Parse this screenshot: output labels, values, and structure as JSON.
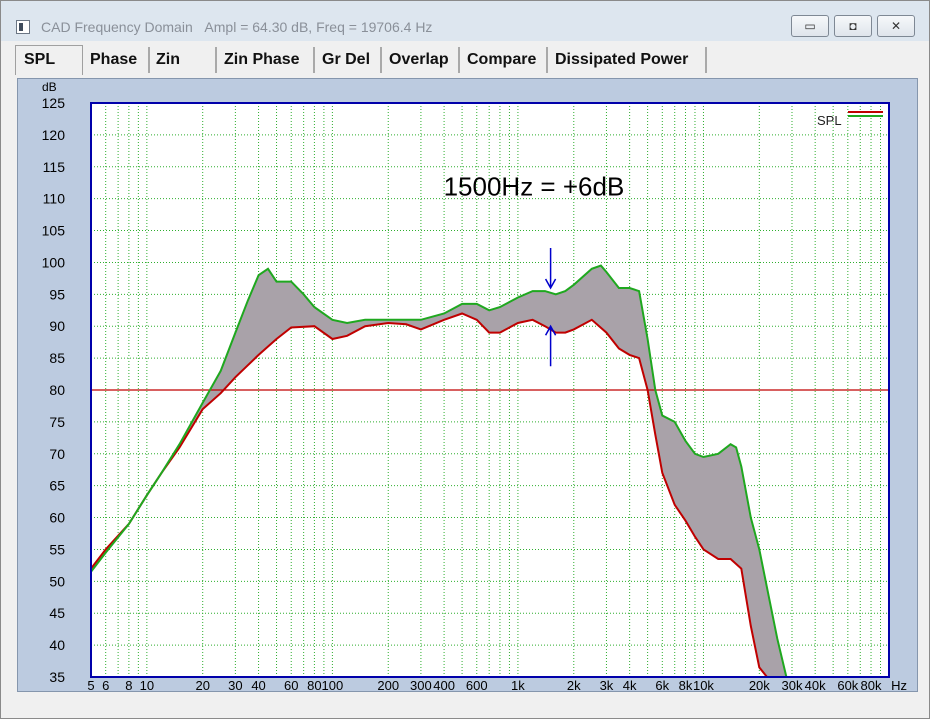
{
  "window": {
    "title": "CAD Frequency Domain",
    "readout": "Ampl = 64.30 dB, Freq = 19706.4 Hz",
    "buttons": {
      "minimize": "▭",
      "maximize": "◘",
      "close": "✕"
    }
  },
  "tabs": [
    {
      "label": "SPL"
    },
    {
      "label": "Phase"
    },
    {
      "label": "Zin"
    },
    {
      "label": "Zin Phase"
    },
    {
      "label": "Gr Del"
    },
    {
      "label": "Overlap"
    },
    {
      "label": "Compare"
    },
    {
      "label": "Dissipated Power"
    }
  ],
  "active_tab": "SPL",
  "colors": {
    "plot_bg": "#ffffff",
    "plot_border": "#0000aa",
    "grid": "#2fae2f",
    "series_red": "#c00000",
    "series_green": "#1fa81f",
    "fill": "#a9a2a9",
    "reference_line": "#c00000",
    "annotation": "#0000cc"
  },
  "chart_data": {
    "type": "line",
    "ylabel": "dB",
    "ylim": [
      35,
      125
    ],
    "xlim": [
      5,
      100000
    ],
    "x_scale": "log",
    "y_ticks": [
      35,
      40,
      45,
      50,
      55,
      60,
      65,
      70,
      75,
      80,
      85,
      90,
      95,
      100,
      105,
      110,
      115,
      120,
      125
    ],
    "x_tick_labels": [
      "5",
      "6",
      "8",
      "10",
      "20",
      "30",
      "40",
      "60",
      "80",
      "100",
      "200",
      "300",
      "400",
      "600",
      "1k",
      "2k",
      "3k",
      "4k",
      "6k",
      "8k",
      "10k",
      "20k",
      "30k",
      "40k",
      "60k",
      "80k",
      "Hz"
    ],
    "x_tick_values": [
      5,
      6,
      8,
      10,
      20,
      30,
      40,
      60,
      80,
      100,
      200,
      300,
      400,
      600,
      1000,
      2000,
      3000,
      4000,
      6000,
      8000,
      10000,
      20000,
      30000,
      40000,
      60000,
      80000,
      100000
    ],
    "grid": true,
    "legend": {
      "label": "SPL",
      "placement": "top-right"
    },
    "reference_level": 80,
    "annotation": {
      "text": "1500Hz = +6dB",
      "freq": 1500,
      "y_low": 90,
      "y_high": 96
    },
    "series": [
      {
        "color": "#c00000",
        "points": [
          [
            5,
            52
          ],
          [
            6,
            55
          ],
          [
            8,
            59
          ],
          [
            10,
            63.5
          ],
          [
            12,
            67
          ],
          [
            15,
            71
          ],
          [
            20,
            77
          ],
          [
            25,
            79.5
          ],
          [
            30,
            82
          ],
          [
            40,
            85.5
          ],
          [
            50,
            88
          ],
          [
            60,
            89.8
          ],
          [
            80,
            90
          ],
          [
            100,
            88
          ],
          [
            120,
            88.5
          ],
          [
            150,
            90
          ],
          [
            200,
            90.5
          ],
          [
            250,
            90.3
          ],
          [
            300,
            89.5
          ],
          [
            400,
            91
          ],
          [
            500,
            92
          ],
          [
            600,
            91
          ],
          [
            700,
            89
          ],
          [
            800,
            89
          ],
          [
            1000,
            90.5
          ],
          [
            1200,
            91
          ],
          [
            1400,
            90
          ],
          [
            1600,
            89
          ],
          [
            1800,
            89
          ],
          [
            2000,
            89.5
          ],
          [
            2500,
            91
          ],
          [
            3000,
            89
          ],
          [
            3500,
            86.5
          ],
          [
            4000,
            85.5
          ],
          [
            4500,
            85
          ],
          [
            5000,
            80
          ],
          [
            5500,
            73
          ],
          [
            6000,
            67
          ],
          [
            7000,
            62
          ],
          [
            8000,
            59.5
          ],
          [
            9000,
            57
          ],
          [
            10000,
            55
          ],
          [
            12000,
            53.5
          ],
          [
            14000,
            53.5
          ],
          [
            16000,
            52
          ],
          [
            18000,
            43
          ],
          [
            20000,
            36.5
          ],
          [
            22000,
            35
          ],
          [
            100000,
            35
          ]
        ]
      },
      {
        "color": "#1fa81f",
        "points": [
          [
            5,
            51.5
          ],
          [
            6,
            54.5
          ],
          [
            8,
            59
          ],
          [
            10,
            63.5
          ],
          [
            12,
            67
          ],
          [
            15,
            71.5
          ],
          [
            20,
            78
          ],
          [
            25,
            83
          ],
          [
            30,
            89
          ],
          [
            35,
            94
          ],
          [
            40,
            98
          ],
          [
            45,
            99
          ],
          [
            50,
            97
          ],
          [
            60,
            97
          ],
          [
            70,
            95
          ],
          [
            80,
            93
          ],
          [
            100,
            91
          ],
          [
            120,
            90.5
          ],
          [
            150,
            91
          ],
          [
            200,
            91
          ],
          [
            250,
            91
          ],
          [
            300,
            91
          ],
          [
            400,
            92
          ],
          [
            500,
            93.5
          ],
          [
            600,
            93.5
          ],
          [
            700,
            92.5
          ],
          [
            800,
            93
          ],
          [
            1000,
            94.5
          ],
          [
            1200,
            95.5
          ],
          [
            1400,
            95.5
          ],
          [
            1600,
            95
          ],
          [
            1800,
            95.5
          ],
          [
            2000,
            96.5
          ],
          [
            2500,
            99
          ],
          [
            2800,
            99.5
          ],
          [
            3000,
            98.5
          ],
          [
            3500,
            96
          ],
          [
            4000,
            96
          ],
          [
            4500,
            95.5
          ],
          [
            5000,
            88
          ],
          [
            5500,
            80
          ],
          [
            6000,
            76
          ],
          [
            7000,
            75
          ],
          [
            8000,
            72
          ],
          [
            9000,
            70
          ],
          [
            10000,
            69.5
          ],
          [
            12000,
            70
          ],
          [
            14000,
            71.5
          ],
          [
            15000,
            71
          ],
          [
            16000,
            68
          ],
          [
            18000,
            60
          ],
          [
            20000,
            55
          ],
          [
            22000,
            49
          ],
          [
            25000,
            41
          ],
          [
            28000,
            35
          ],
          [
            100000,
            35
          ]
        ]
      }
    ]
  }
}
